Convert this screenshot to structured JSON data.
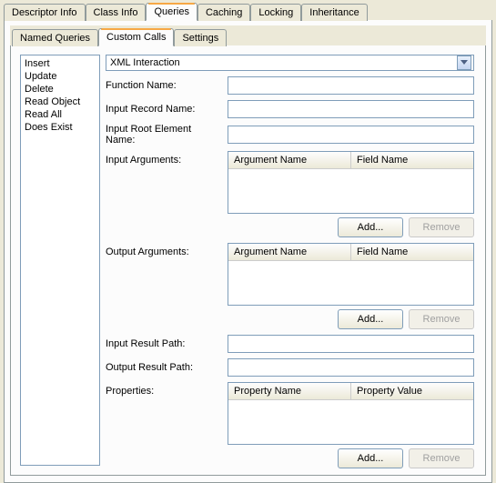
{
  "topTabs": {
    "descriptor": "Descriptor Info",
    "classinfo": "Class Info",
    "queries": "Queries",
    "caching": "Caching",
    "locking": "Locking",
    "inheritance": "Inheritance"
  },
  "innerTabs": {
    "named": "Named Queries",
    "custom": "Custom Calls",
    "settings": "Settings"
  },
  "queryTypes": [
    "Insert",
    "Update",
    "Delete",
    "Read Object",
    "Read All",
    "Does Exist"
  ],
  "dropdown": {
    "value": "XML Interaction"
  },
  "labels": {
    "functionName": "Function Name:",
    "inputRecordName": "Input Record Name:",
    "inputRootElementName": "Input Root Element Name:",
    "inputArguments": "Input Arguments:",
    "outputArguments": "Output Arguments:",
    "inputResultPath": "Input Result Path:",
    "outputResultPath": "Output Result Path:",
    "properties": "Properties:"
  },
  "columns": {
    "argumentName": "Argument Name",
    "fieldName": "Field Name",
    "propertyName": "Property Name",
    "propertyValue": "Property Value"
  },
  "buttons": {
    "add": "Add...",
    "remove": "Remove"
  },
  "fields": {
    "functionName": "",
    "inputRecordName": "",
    "inputRootElementName": "",
    "inputResultPath": "",
    "outputResultPath": ""
  }
}
